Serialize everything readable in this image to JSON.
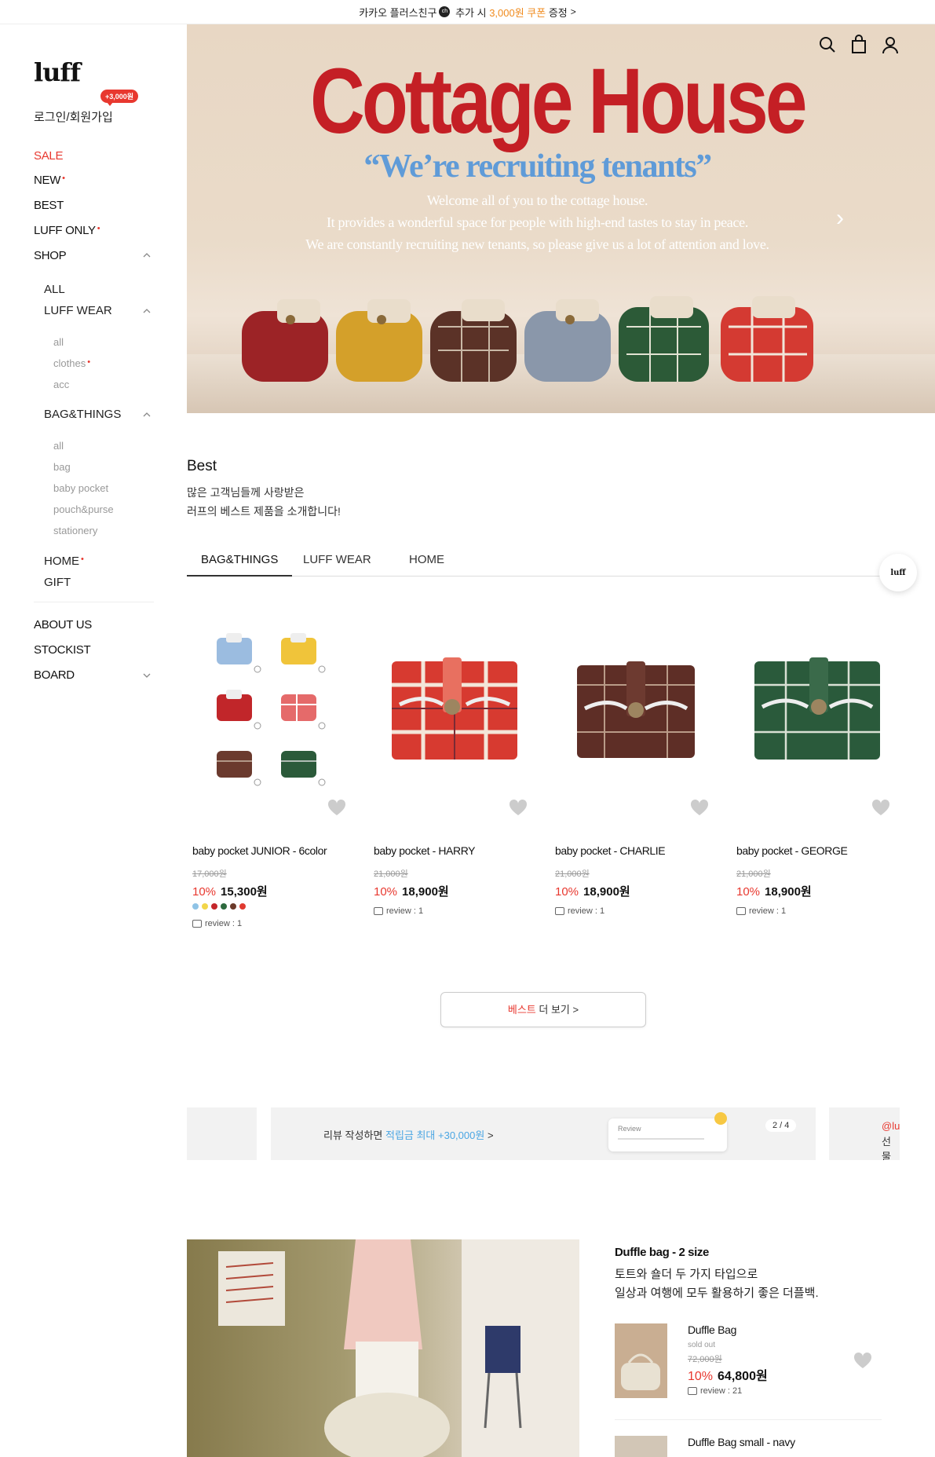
{
  "top_banner": {
    "pre": "카카오 플러스친구",
    "kakao_badge": "ch",
    "mid": " 추가 시 ",
    "highlight": "3,000원 쿠폰",
    "post": " 증정",
    "chevron": ">",
    "highlight_color": "#f08b1e"
  },
  "sidebar": {
    "logo": "luff",
    "login": "로그인/회원가입",
    "bubble": "+3,000원",
    "nav": {
      "sale": "SALE",
      "new": "NEW",
      "best": "BEST",
      "luff_only": "LUFF ONLY",
      "shop": "SHOP",
      "all": "ALL",
      "luff_wear": "LUFF WEAR",
      "wear_all": "all",
      "wear_clothes": "clothes",
      "wear_acc": "acc",
      "bag_things": "BAG&THINGS",
      "bag_all": "all",
      "bag_bag": "bag",
      "bag_baby_pocket": "baby pocket",
      "bag_pouch": "pouch&purse",
      "bag_stationery": "stationery",
      "home": "HOME",
      "gift": "GIFT",
      "about": "ABOUT US",
      "stockist": "STOCKIST",
      "board": "BOARD"
    },
    "new_marker": "•",
    "accent_color": "#e8382f"
  },
  "hero": {
    "title": "Cottage House",
    "subtitle": "“We’re recruiting tenants”",
    "line1": "Welcome all of you to the cottage house.",
    "line2": "It provides a wonderful space for people with high-end tastes to stay in peace.",
    "line3": "We are constantly recruiting new tenants, so please give us a lot of attention and love.",
    "next_arrow": "›",
    "title_color": "#c41f25",
    "subtitle_color": "#5f9bd8",
    "icons": [
      "search-icon",
      "shopping-bag-icon",
      "user-icon"
    ]
  },
  "best": {
    "title": "Best",
    "desc1": "많은 고객님들께 사랑받은",
    "desc2": "러프의 베스트 제품을 소개합니다!",
    "tabs": [
      "BAG&THINGS",
      "LUFF WEAR",
      "HOME"
    ],
    "float_logo": "luff",
    "products": [
      {
        "name": "baby pocket JUNIOR - 6color",
        "orig": "17,000원",
        "disc": "10%",
        "price": "15,300원",
        "review": "review : 1",
        "colors": [
          "#8fc3e6",
          "#f2d64a",
          "#c4262b",
          "#2e6a3e",
          "#6b3a2a",
          "#e03a30"
        ]
      },
      {
        "name": "baby pocket - HARRY",
        "orig": "21,000원",
        "disc": "10%",
        "price": "18,900원",
        "review": "review : 1"
      },
      {
        "name": "baby pocket - CHARLIE",
        "orig": "21,000원",
        "disc": "10%",
        "price": "18,900원",
        "review": "review : 1"
      },
      {
        "name": "baby pocket - GEORGE",
        "orig": "21,000원",
        "disc": "10%",
        "price": "18,900원",
        "review": "review : 1"
      }
    ],
    "more_red": "베스트",
    "more_rest": " 더 보기 >"
  },
  "review_slider": {
    "text_pre": "리뷰 작성하면 ",
    "text_hl": "적립금 최대 +30,000원",
    "text_chev": " >",
    "card_label": "Review",
    "page": "2 / 4",
    "right_text1": "@lu",
    "right_text2": "선물",
    "highlight_color": "#4ba6e3"
  },
  "feature": {
    "title": "Duffle bag - 2 size",
    "line1": "토트와 숄더 두 가지 타입으로",
    "line2": "일상과 여행에 모두 활용하기 좋은 더플백.",
    "items": [
      {
        "name": "Duffle Bag",
        "sold": "sold out",
        "orig": "72,000원",
        "disc": "10%",
        "price": "64,800원",
        "review": "review : 21"
      },
      {
        "name": "Duffle Bag small - navy"
      }
    ]
  }
}
